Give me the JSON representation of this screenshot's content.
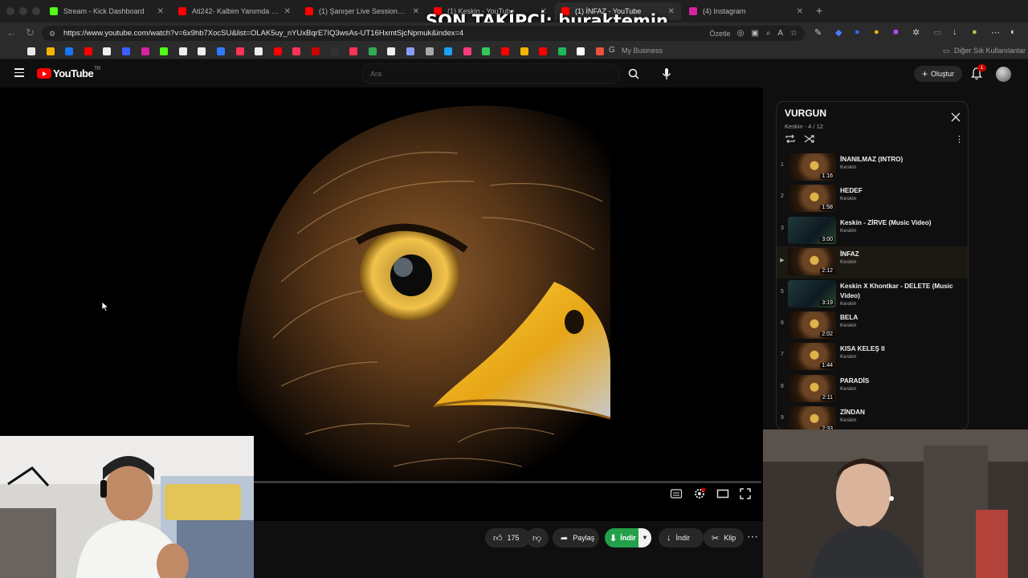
{
  "browser": {
    "tabs": [
      {
        "label": "Stream - Kick Dashboard",
        "color": "#53fc18",
        "active": false
      },
      {
        "label": "Ati242- Kalbim Yanımda (Offici...",
        "color": "#ff0000",
        "active": false
      },
      {
        "label": "(1) Şanışer Live Sessions - Çan...",
        "color": "#ff0000",
        "active": false
      },
      {
        "label": "(1) Keskin - YouTube",
        "color": "#ff0000",
        "active": false
      },
      {
        "label": "(1) İNFAZ - YouTube",
        "color": "#ff0000",
        "active": true
      },
      {
        "label": "(4) Instagram",
        "color": "#d6249f",
        "active": false
      }
    ],
    "url": "https://www.youtube.com/watch?v=6x9hb7XocSU&list=OLAK5uy_nYUxBqrE7IQ3wsAs-UT16HxmtSjcNpmuk&index=4",
    "summarize_label": "Özetle",
    "bookmarks_other_label": "Diğer Sık Kullanılanlar",
    "bookmark_business_label": "My Business"
  },
  "stream_overlay": {
    "text": "SON TAKİPÇİ: buraktemin"
  },
  "youtube": {
    "logo_text": "YouTube",
    "region": "TR",
    "search_placeholder": "Ara",
    "create_label": "Oluştur",
    "notification_count": "1"
  },
  "actions": {
    "like_count": "175",
    "share_label": "Paylaş",
    "download_green_label": "İndir",
    "download_label": "İndir",
    "clip_label": "Klip"
  },
  "playlist": {
    "title": "VURGUN",
    "subtitle": "Keskin - 4 / 12",
    "current_index": 4,
    "items": [
      {
        "index": "1",
        "title": "İNANILMAZ (INTRO)",
        "channel": "Keskin",
        "duration": "1:16",
        "thumb": "eagle"
      },
      {
        "index": "2",
        "title": "HEDEF",
        "channel": "Keskin",
        "duration": "1:58",
        "thumb": "eagle"
      },
      {
        "index": "3",
        "title": "Keskin - ZİRVE (Music Video)",
        "channel": "Keskin",
        "duration": "3:00",
        "thumb": "scene"
      },
      {
        "index": "▶",
        "title": "İNFAZ",
        "channel": "Keskin",
        "duration": "2:12",
        "thumb": "eagle"
      },
      {
        "index": "5",
        "title": "Keskin X Khontkar - DELETE (Music Video)",
        "channel": "Keskin",
        "duration": "3:19",
        "thumb": "scene"
      },
      {
        "index": "6",
        "title": "BELA",
        "channel": "Keskin",
        "duration": "2:02",
        "thumb": "eagle"
      },
      {
        "index": "7",
        "title": "KISA KELEŞ II",
        "channel": "Keskin",
        "duration": "1:44",
        "thumb": "eagle"
      },
      {
        "index": "8",
        "title": "PARADİS",
        "channel": "Keskin",
        "duration": "2:11",
        "thumb": "eagle"
      },
      {
        "index": "9",
        "title": "ZİNDAN",
        "channel": "Keskin",
        "duration": "2:33",
        "thumb": "eagle"
      }
    ]
  },
  "colors": {
    "accent_red": "#ff0000",
    "download_green": "#22a04a",
    "background": "#0f0f0f"
  }
}
